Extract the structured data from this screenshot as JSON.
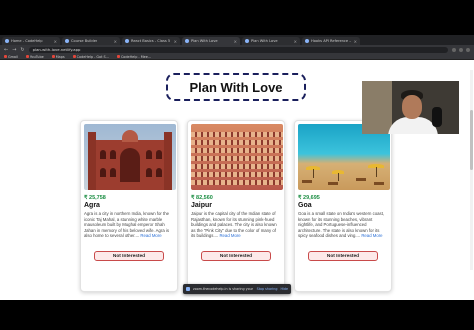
{
  "browser": {
    "tabs": [
      {
        "label": "Home - CodeHelp",
        "active": false
      },
      {
        "label": "Course Builder",
        "active": false
      },
      {
        "label": "React Basics - Class 5",
        "active": false
      },
      {
        "label": "Plan With Love",
        "active": true
      },
      {
        "label": "Plan With Love",
        "active": false
      },
      {
        "label": "Hooks API Reference – React",
        "active": false
      }
    ],
    "url": "plan-with-love.netlify.app",
    "bookmarks": [
      {
        "label": "Gmail"
      },
      {
        "label": "YouTube"
      },
      {
        "label": "Maps"
      },
      {
        "label": "CodeHelp - Got S..."
      },
      {
        "label": "CodeHelp - Mee..."
      }
    ]
  },
  "page": {
    "title": "Plan With Love"
  },
  "tours": [
    {
      "price": "₹ 25,758",
      "city": "Agra",
      "desc": "Agra is a city in northern India, known for the iconic Taj Mahal, a stunning white marble mausoleum built by Mughal emperor Shah Jahan in memory of his beloved wife. Agra is also home to several other....",
      "read_more": "Read More",
      "button": "Not Interested"
    },
    {
      "price": "₹ 82,560",
      "city": "Jaipur",
      "desc": "Jaipur is the capital city of the Indian state of Rajasthan, known for its stunning pink-hued buildings and palaces. The city is also known as the \"Pink City\" due to the color of many of its buildings....",
      "read_more": "Read More",
      "button": "Not Interested"
    },
    {
      "price": "₹ 29,695",
      "city": "Goa",
      "desc": "Goa is a small state on India's western coast, known for its stunning beaches, vibrant nightlife, and Portuguese-influenced architecture. The state is also known for its spicy seafood dishes and ving....",
      "read_more": "Read More",
      "button": "Not Interested"
    }
  ],
  "sharebar": {
    "text": "zoom.thecodehelp.in is sharing your screen.",
    "stop": "Stop sharing",
    "hide": "Hide"
  }
}
